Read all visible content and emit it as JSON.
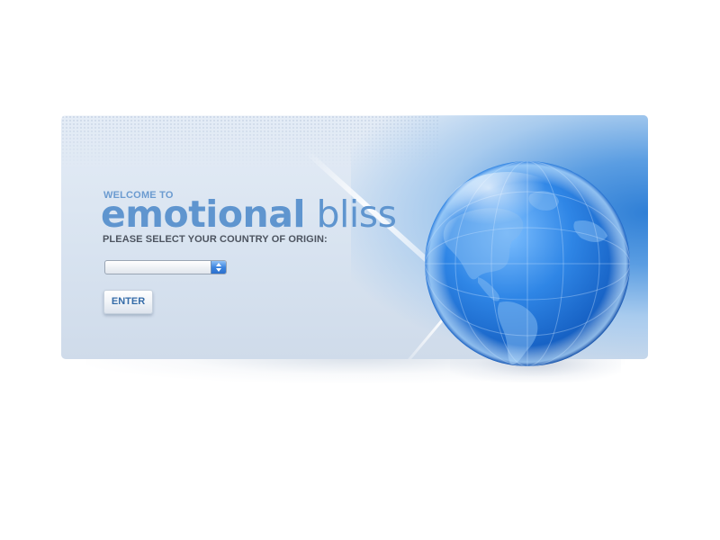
{
  "welcome_text": "WELCOME TO",
  "brand": {
    "part1": "emotional",
    "part2": "bliss"
  },
  "prompt_text": "PLEASE SELECT YOUR COUNTRY OF ORIGIN:",
  "country_select": {
    "selected_value": ""
  },
  "enter_button": {
    "label": "ENTER"
  },
  "colors": {
    "brand_blue": "#5f95cf",
    "welcome_blue": "#6b9bd0",
    "prompt_gray": "#4d5460",
    "button_text": "#356ca8",
    "globe_blue": "#1f6fd0"
  },
  "icons": {
    "select_arrows": "up-down-arrows-icon",
    "globe": "globe-icon"
  }
}
